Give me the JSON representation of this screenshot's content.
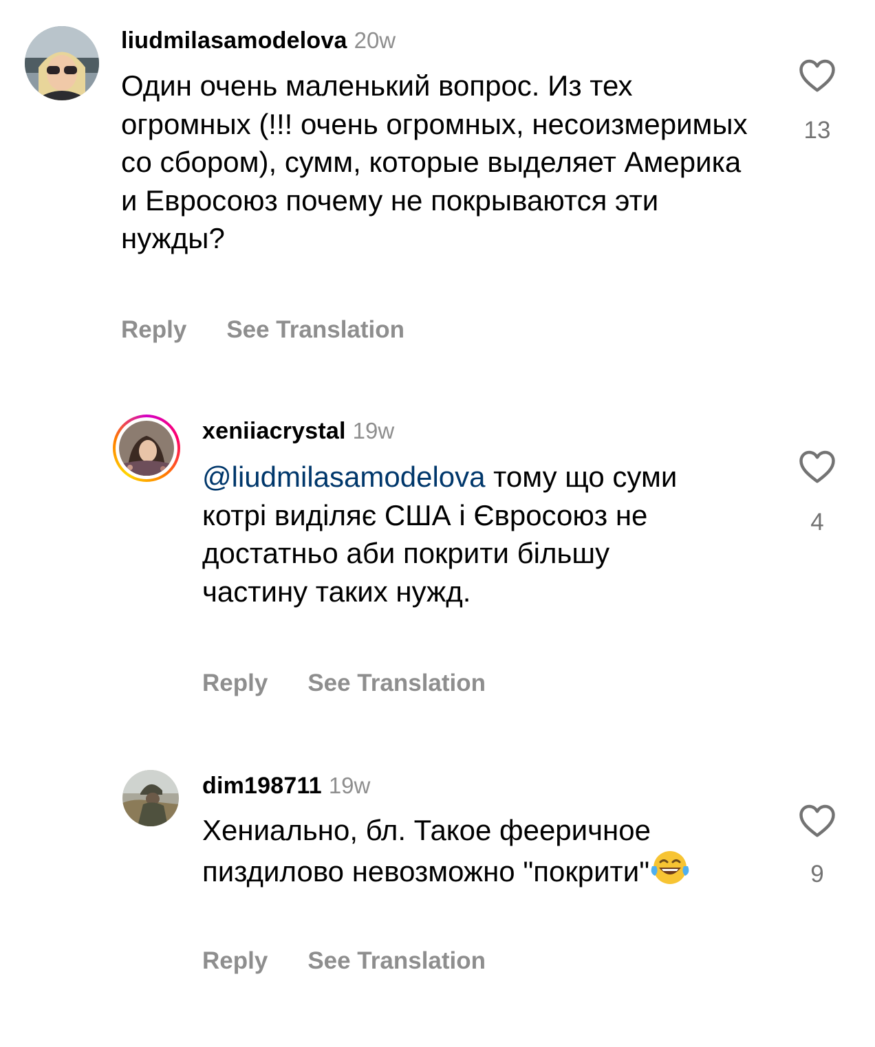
{
  "comments": [
    {
      "username": "liudmilasamodelova",
      "time": "20w",
      "text": "Один очень маленький вопрос. Из тех огромных (!!! очень огромных, несоизмеримых со сбором), сумм, которые выделяет Америка и Евросоюз почему не покрываются эти нужды?",
      "likes": "13",
      "reply_label": "Reply",
      "translate_label": "See Translation"
    },
    {
      "username": "xeniiacrystal",
      "time": "19w",
      "mention": "@liudmilasamodelova",
      "text": " тому що суми котрі виділяє США і Євросоюз не достатньо аби покрити більшу частину таких нужд.",
      "likes": "4",
      "reply_label": "Reply",
      "translate_label": "See Translation",
      "story_ring": true
    },
    {
      "username": "dim198711",
      "time": "19w",
      "text": "Хениально, бл. Такое фееричное пиздилово невозможно \"покрити\"",
      "emoji": "face-with-tears-of-joy",
      "likes": "9",
      "reply_label": "Reply",
      "translate_label": "See Translation"
    }
  ],
  "colors": {
    "mention": "#00376b",
    "secondary_text": "#8e8e8e",
    "story_ring": [
      "#d300c5",
      "#ff0069",
      "#ff7a00",
      "#ffd600"
    ]
  }
}
